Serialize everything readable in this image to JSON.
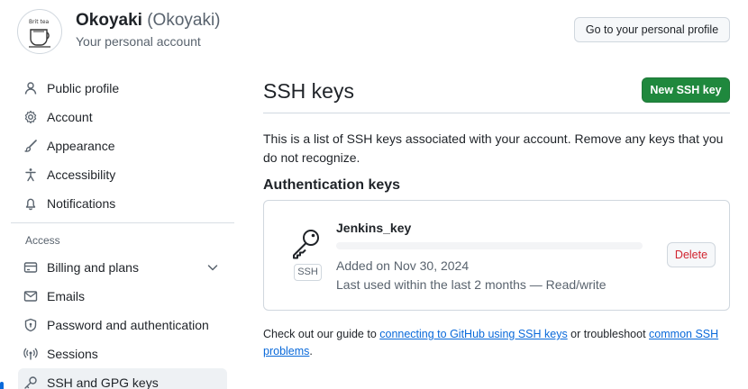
{
  "header": {
    "user_name": "Okoyaki",
    "user_login": "(Okoyaki)",
    "account_type": "Your personal account",
    "profile_button": "Go to your personal profile",
    "avatar_text": "Brit tea"
  },
  "sidebar": {
    "items": [
      {
        "label": "Public profile",
        "icon": "person-icon"
      },
      {
        "label": "Account",
        "icon": "gear-icon"
      },
      {
        "label": "Appearance",
        "icon": "paintbrush-icon"
      },
      {
        "label": "Accessibility",
        "icon": "accessibility-icon"
      },
      {
        "label": "Notifications",
        "icon": "bell-icon"
      }
    ],
    "access_heading": "Access",
    "access_items": [
      {
        "label": "Billing and plans",
        "icon": "credit-card-icon"
      },
      {
        "label": "Emails",
        "icon": "mail-icon"
      },
      {
        "label": "Password and authentication",
        "icon": "shield-lock-icon"
      },
      {
        "label": "Sessions",
        "icon": "broadcast-icon"
      },
      {
        "label": "SSH and GPG keys",
        "icon": "key-icon"
      }
    ]
  },
  "main": {
    "title": "SSH keys",
    "new_key_button": "New SSH key",
    "description": "This is a list of SSH keys associated with your account. Remove any keys that you do not recognize.",
    "section_title": "Authentication keys",
    "keys": [
      {
        "name": "Jenkins_key",
        "badge": "SSH",
        "added": "Added on Nov 30, 2024",
        "last_used": "Last used within the last 2 months — Read/write",
        "delete_label": "Delete"
      }
    ],
    "help": {
      "prefix": "Check out our guide to ",
      "link1": "connecting to GitHub using SSH keys",
      "middle": " or troubleshoot ",
      "link2": "common SSH problems",
      "suffix": "."
    }
  },
  "colors": {
    "accent": "#0969da",
    "primary_button": "#1f883d",
    "danger": "#d1242f",
    "muted_text": "#59636e",
    "border": "#d0d7de"
  }
}
